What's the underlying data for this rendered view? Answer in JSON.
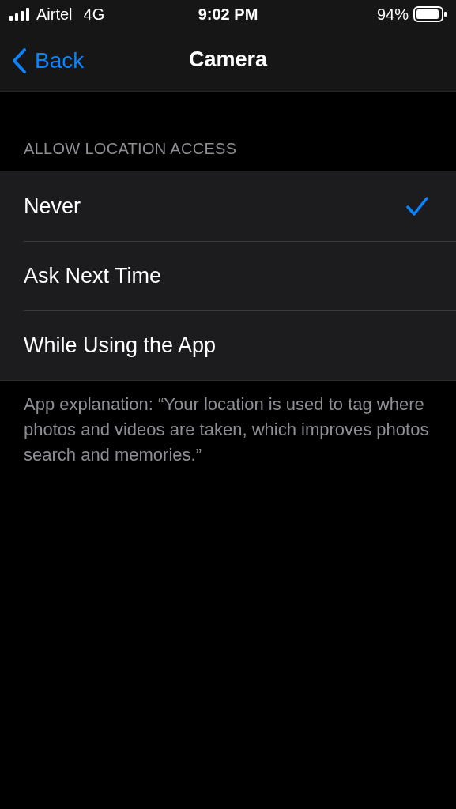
{
  "status_bar": {
    "carrier": "Airtel",
    "network": "4G",
    "time": "9:02 PM",
    "battery": "94%"
  },
  "nav": {
    "back": "Back",
    "title": "Camera"
  },
  "section": {
    "header": "ALLOW LOCATION ACCESS",
    "options": [
      {
        "label": "Never",
        "selected": true
      },
      {
        "label": "Ask Next Time",
        "selected": false
      },
      {
        "label": "While Using the App",
        "selected": false
      }
    ],
    "footer": "App explanation: “Your location is used to tag where photos and videos are taken, which improves photos search and memories.”"
  }
}
